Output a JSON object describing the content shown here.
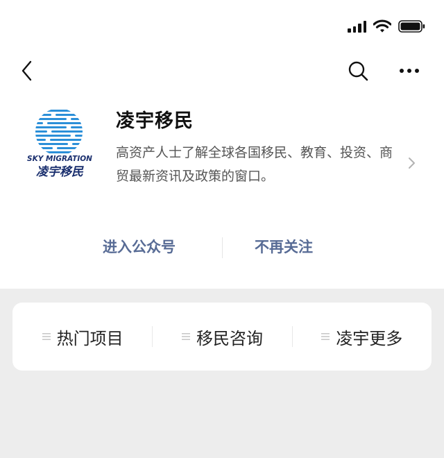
{
  "account": {
    "name": "凌宇移民",
    "description": "高资产人士了解全球各国移民、教育、投资、商贸最新资讯及政策的窗口。",
    "logo": {
      "english": "SKY MIGRATION",
      "chinese": "凌宇移民"
    }
  },
  "actions": {
    "enter_label": "进入公众号",
    "unfollow_label": "不再关注"
  },
  "menu": [
    {
      "label": "热门项目"
    },
    {
      "label": "移民咨询"
    },
    {
      "label": "凌宇更多"
    }
  ],
  "colors": {
    "link": "#576b95",
    "background": "#ededed",
    "logo_blue": "#2b8fd8"
  },
  "icons": {
    "back": "chevron-left-icon",
    "search": "search-icon",
    "more": "more-icon",
    "signal": "cellular-signal-icon",
    "wifi": "wifi-icon",
    "battery": "battery-icon"
  }
}
